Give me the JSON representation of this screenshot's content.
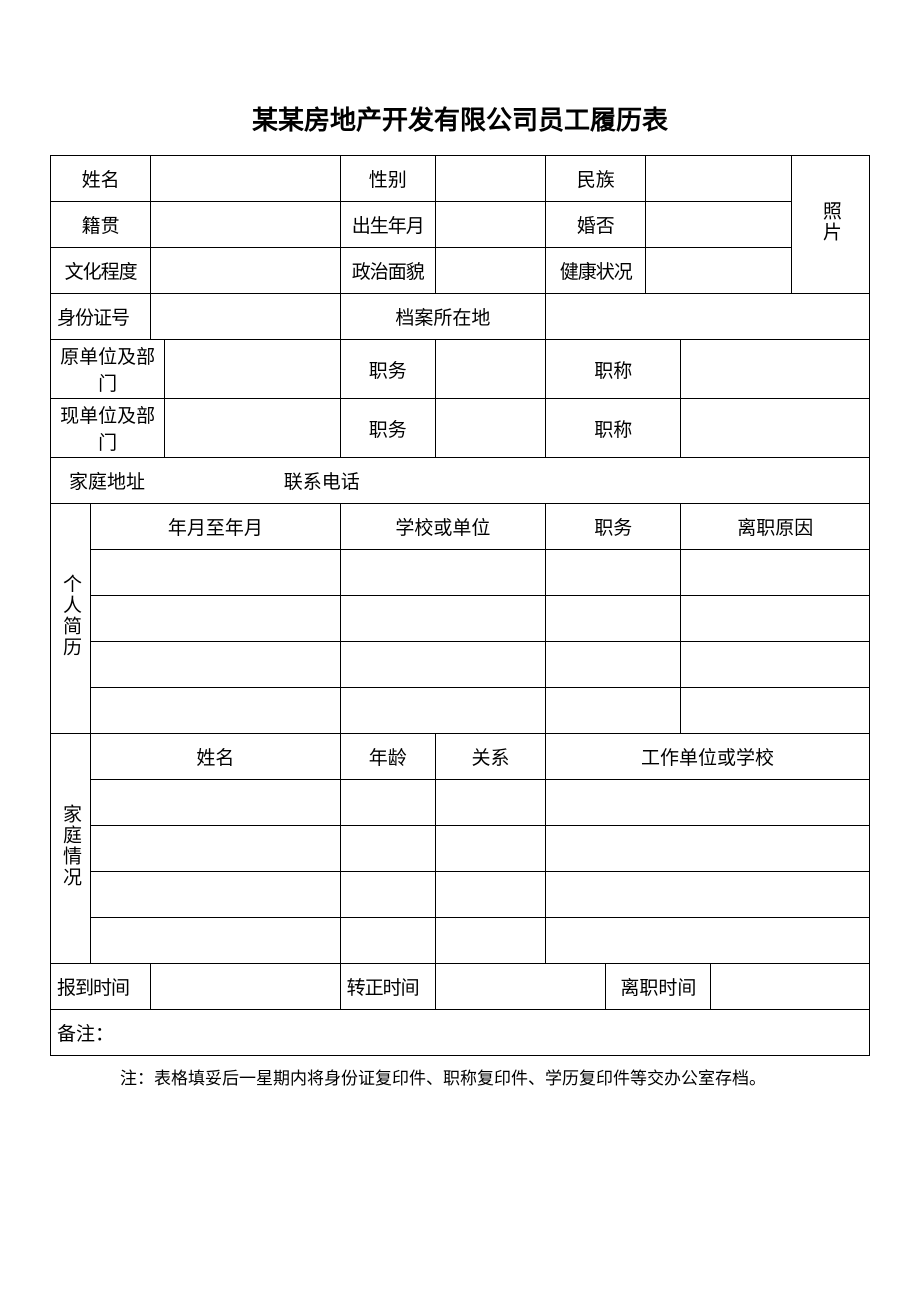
{
  "title": "某某房地产开发有限公司员工履历表",
  "labels": {
    "name": "姓名",
    "gender": "性别",
    "ethnicity": "民族",
    "photo": "照片",
    "native_place": "籍贯",
    "birth": "出生年月",
    "married": "婚否",
    "education": "文化程度",
    "politics": "政治面貌",
    "health": "健康状况",
    "id_number": "身份证号",
    "archive_loc": "档案所在地",
    "former_unit": "原单位及部门",
    "current_unit": "现单位及部门",
    "position": "职务",
    "title": "职称",
    "home_addr": "家庭地址",
    "phone": "联系电话",
    "resume": "个人简历",
    "period": "年月至年月",
    "school_unit": "学校或单位",
    "leave_reason": "离职原因",
    "family": "家庭情况",
    "age": "年龄",
    "relation": "关系",
    "work_school": "工作单位或学校",
    "report_time": "报到时间",
    "regular_time": "转正时间",
    "leave_time": "离职时间",
    "remark": "备注："
  },
  "footnote": "注：表格填妥后一星期内将身份证复印件、职称复印件、学历复印件等交办公室存档。"
}
